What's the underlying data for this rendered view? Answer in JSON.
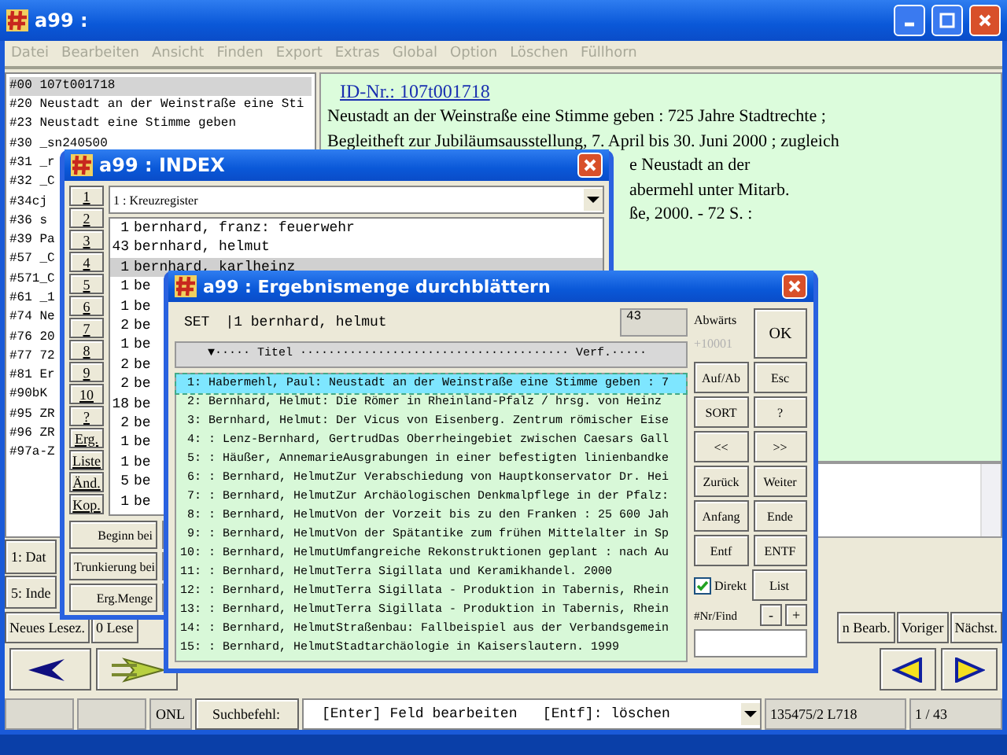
{
  "window": {
    "title": "a99 :"
  },
  "menu": [
    "Datei",
    "Bearbeiten",
    "Ansicht",
    "Finden",
    "Export",
    "Extras",
    "Global",
    "Option",
    "Löschen",
    "Füllhorn"
  ],
  "fields": [
    "#00 107t001718",
    "#20 Neustadt an der Weinstraße eine Sti",
    "#23 Neustadt eine Stimme geben",
    "#30 _sn240500",
    "#31 _r",
    "#32 _C",
    "#34cj",
    "#36 s",
    "#39 Pa",
    "#57 _C",
    "#571_C",
    "#61 _1",
    "#74 Ne",
    "#76 20",
    "#77 72",
    "#81 Er",
    "#90bK",
    "#95 ZR",
    "#96 ZR",
    "#97a-Z"
  ],
  "record": {
    "id_link": "ID-Nr.: 107t001718",
    "lines": [
      {
        "kind": "full",
        "text": "Neustadt an der Weinstraße eine Stimme geben : 725 Jahre Stadtrechte ;"
      },
      {
        "kind": "full",
        "text": "Begleitheft zur Jubiläumsausstellung, 7. April bis 30. Juni 2000 ; zugleich"
      },
      {
        "kind": "partial",
        "text": "e Neustadt an der"
      },
      {
        "kind": "partial",
        "text": "abermehl unter Mitarb."
      },
      {
        "kind": "partial",
        "text": "ße, 2000. - 72 S. :"
      }
    ]
  },
  "side_buttons": [
    "1: Dat",
    "5: Inde"
  ],
  "action_buttons": {
    "left": [
      "Neues Lesez.",
      "0 Lese"
    ],
    "right": [
      "n Bearb.",
      "Voriger",
      "Nächst."
    ]
  },
  "status_bar": {
    "mode": "ONL",
    "search_button": "Suchbefehl:",
    "command_hint": "[Enter] Feld bearbeiten   [Entf]: löschen",
    "position": "135475/2 L718",
    "count": "1 / 43"
  },
  "index_window": {
    "title": "a99 : INDEX",
    "number_buttons": [
      "1",
      "2",
      "3",
      "4",
      "5",
      "6",
      "7",
      "8",
      "9",
      "10",
      "?",
      "Erg.",
      "Liste",
      "Änd.",
      "Kop."
    ],
    "register": "1 : Kreuzregister",
    "rows": [
      {
        "count": "1",
        "term": "bernhard, franz: feuerwehr",
        "selected": false
      },
      {
        "count": "43",
        "term": "bernhard, helmut",
        "selected": false
      },
      {
        "count": "1",
        "term": "bernhard, karlheinz",
        "selected": true
      },
      {
        "count": "1",
        "term": "be",
        "selected": false
      },
      {
        "count": "1",
        "term": "be",
        "selected": false
      },
      {
        "count": "2",
        "term": "be",
        "selected": false
      },
      {
        "count": "1",
        "term": "be",
        "selected": false
      },
      {
        "count": "2",
        "term": "be",
        "selected": false
      },
      {
        "count": "2",
        "term": "be",
        "selected": false
      },
      {
        "count": "18",
        "term": "be",
        "selected": false
      },
      {
        "count": "2",
        "term": "be",
        "selected": false
      },
      {
        "count": "1",
        "term": "be",
        "selected": false
      },
      {
        "count": "1",
        "term": "be",
        "selected": false
      },
      {
        "count": "5",
        "term": "be",
        "selected": false
      },
      {
        "count": "1",
        "term": "be",
        "selected": false
      }
    ],
    "bottom_buttons": [
      "Beginn bei",
      "Trunkierung bei",
      "Erg.Menge"
    ]
  },
  "results_window": {
    "title": "a99 : Ergebnismenge durchblättern",
    "set_label": "SET",
    "set_value": "|1 bernhard, helmut",
    "total": "43",
    "header": "▼····· Titel ······································ Verf.·····",
    "rows": [
      {
        "num": "1:",
        "text": "Habermehl, Paul: Neustadt an der Weinstraße eine Stimme geben : 7",
        "selected": true
      },
      {
        "num": "2:",
        "text": "Bernhard, Helmut: Die Römer in Rheinland-Pfalz / hrsg. von Heinz",
        "selected": false
      },
      {
        "num": "3:",
        "text": "Bernhard, Helmut: Der Vicus von Eisenberg. Zentrum römischer Eise",
        "selected": false
      },
      {
        "num": "4:",
        "text": ": Lenz-Bernhard, GertrudDas Oberrheingebiet zwischen Caesars Gall",
        "selected": false
      },
      {
        "num": "5:",
        "text": ": Häußer, AnnemarieAusgrabungen in einer befestigten linienbandke",
        "selected": false
      },
      {
        "num": "6:",
        "text": ": Bernhard, HelmutZur Verabschiedung von Hauptkonservator Dr. Hei",
        "selected": false
      },
      {
        "num": "7:",
        "text": ": Bernhard, HelmutZur Archäologischen Denkmalpflege in der Pfalz:",
        "selected": false
      },
      {
        "num": "8:",
        "text": ": Bernhard, HelmutVon der Vorzeit bis zu den Franken : 25 600 Jah",
        "selected": false
      },
      {
        "num": "9:",
        "text": ": Bernhard, HelmutVon der Spätantike zum frühen Mittelalter in Sp",
        "selected": false
      },
      {
        "num": "10:",
        "text": ": Bernhard, HelmutUmfangreiche Rekonstruktionen geplant : nach Au",
        "selected": false
      },
      {
        "num": "11:",
        "text": ": Bernhard, HelmutTerra Sigillata und Keramikhandel. 2000",
        "selected": false
      },
      {
        "num": "12:",
        "text": ": Bernhard, HelmutTerra Sigillata - Produktion in Tabernis, Rhein",
        "selected": false
      },
      {
        "num": "13:",
        "text": ": Bernhard, HelmutTerra Sigillata - Produktion in Tabernis, Rhein",
        "selected": false
      },
      {
        "num": "14:",
        "text": ": Bernhard, HelmutStraßenbau: Fallbeispiel aus der Verbandsgemein",
        "selected": false
      },
      {
        "num": "15:",
        "text": ": Bernhard, HelmutStadtarchäologie in Kaiserslautern. 1999",
        "selected": false
      }
    ],
    "direction_label": "Abwärts",
    "step_label": "+10001",
    "ok": "OK",
    "button_pairs": [
      [
        "Auf/Ab",
        "Esc"
      ],
      [
        "SORT",
        "?"
      ],
      [
        "<<",
        ">>"
      ],
      [
        "Zurück",
        "Weiter"
      ],
      [
        "Anfang",
        "Ende"
      ],
      [
        "Entf",
        "ENTF"
      ]
    ],
    "direct": {
      "label": "Direkt",
      "checked": true
    },
    "list_button": "List",
    "find_label": "#Nr/Find",
    "minus": "-",
    "plus": "+"
  }
}
